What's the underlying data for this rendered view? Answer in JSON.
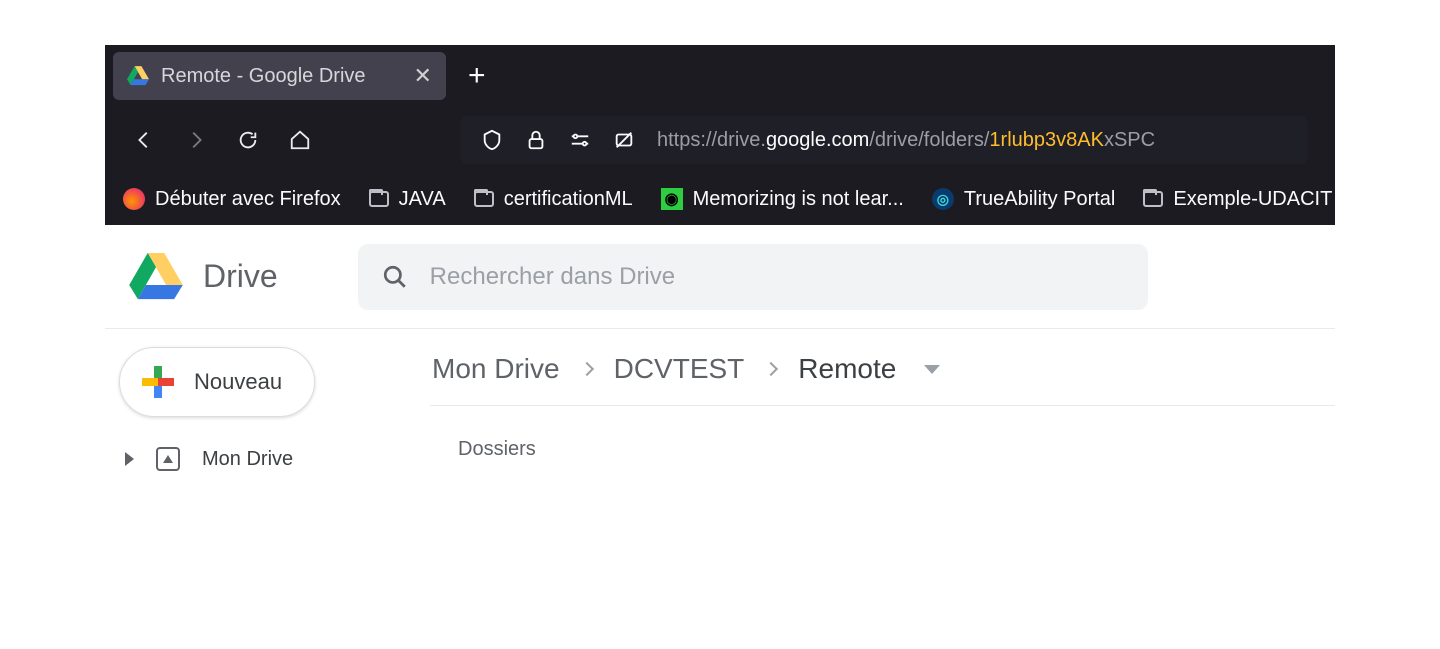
{
  "browser": {
    "tab": {
      "title": "Remote - Google Drive"
    },
    "url": {
      "scheme": "https://",
      "hostPrefix": "drive.",
      "hostMain": "google.com",
      "path": "/drive/folders/",
      "hash": "1rlubp3v8AK",
      "tail": "xSPC"
    },
    "bookmarks": [
      {
        "label": "Débuter avec Firefox",
        "icon": "firefox"
      },
      {
        "label": "JAVA",
        "icon": "folder"
      },
      {
        "label": "certificationML",
        "icon": "folder"
      },
      {
        "label": "Memorizing is not lear...",
        "icon": "green-clock"
      },
      {
        "label": "TrueAbility Portal",
        "icon": "blue-badge"
      },
      {
        "label": "Exemple-UDACIT",
        "icon": "folder"
      }
    ]
  },
  "drive": {
    "title": "Drive",
    "search": {
      "placeholder": "Rechercher dans Drive"
    },
    "newButton": "Nouveau",
    "sidebar": {
      "myDrive": "Mon Drive"
    },
    "breadcrumbs": [
      {
        "label": "Mon Drive"
      },
      {
        "label": "DCVTEST"
      },
      {
        "label": "Remote",
        "current": true
      }
    ],
    "sectionLabel": "Dossiers"
  }
}
